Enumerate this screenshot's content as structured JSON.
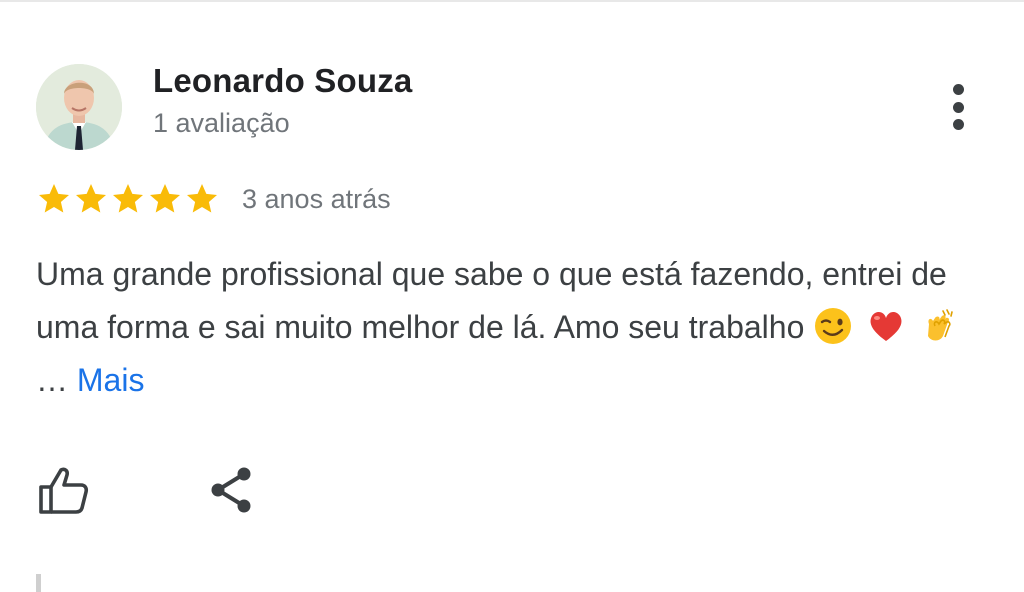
{
  "review": {
    "author": "Leonardo Souza",
    "review_count": "1 avaliação",
    "rating": 5,
    "max_rating": 5,
    "time_ago": "3 anos atrás",
    "text": "Uma grande profissional que sabe o que está fazendo, entrei de uma forma e sai muito melhor de lá. Amo seu trabalho",
    "emojis": [
      "winking-face",
      "red-heart",
      "clapping-hands"
    ],
    "ellipsis": "…",
    "more_label": "Mais"
  },
  "icons": {
    "menu": "more-vertical-icon",
    "like": "thumbs-up-icon",
    "share": "share-icon"
  },
  "colors": {
    "star": "#f9bb08",
    "link": "#1a73e8",
    "name": "#202124",
    "secondary": "#70757a",
    "body": "#3c4043"
  }
}
